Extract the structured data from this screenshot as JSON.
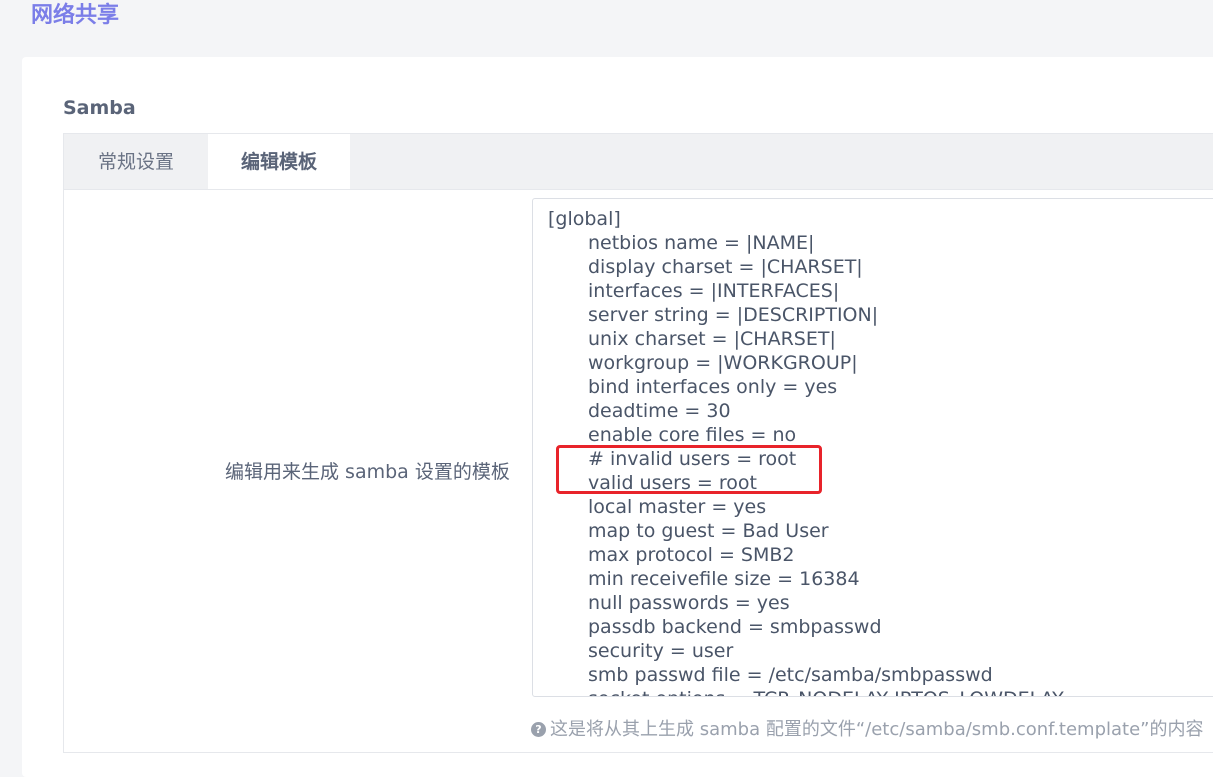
{
  "page": {
    "title": "网络共享"
  },
  "section": {
    "title": "Samba"
  },
  "tabs": [
    {
      "label": "常规设置",
      "active": false
    },
    {
      "label": "编辑模板",
      "active": true
    }
  ],
  "template_field": {
    "label": "编辑用来生成 samba 设置的模板",
    "lines": [
      {
        "text": "[global]",
        "indent": false
      },
      {
        "text": "netbios name = |NAME|",
        "indent": true
      },
      {
        "text": "display charset = |CHARSET|",
        "indent": true
      },
      {
        "text": "interfaces = |INTERFACES|",
        "indent": true
      },
      {
        "text": "server string = |DESCRIPTION|",
        "indent": true
      },
      {
        "text": "unix charset = |CHARSET|",
        "indent": true
      },
      {
        "text": "workgroup = |WORKGROUP|",
        "indent": true
      },
      {
        "text": "bind interfaces only = yes",
        "indent": true
      },
      {
        "text": "deadtime = 30",
        "indent": true
      },
      {
        "text": "enable core files = no",
        "indent": true
      },
      {
        "text": "# invalid users = root",
        "indent": true
      },
      {
        "text": "valid users = root",
        "indent": true
      },
      {
        "text": "local master = yes",
        "indent": true
      },
      {
        "text": "map to guest = Bad User",
        "indent": true
      },
      {
        "text": "max protocol = SMB2",
        "indent": true
      },
      {
        "text": "min receivefile size = 16384",
        "indent": true
      },
      {
        "text": "null passwords = yes",
        "indent": true
      },
      {
        "text": "passdb backend = smbpasswd",
        "indent": true
      },
      {
        "text": "security = user",
        "indent": true
      },
      {
        "text": "smb passwd file = /etc/samba/smbpasswd",
        "indent": true
      },
      {
        "text": "socket options = TCP_NODELAY IPTOS_LOWDELAY",
        "indent": true
      }
    ],
    "help_text": "这是将从其上生成 samba 配置的文件“/etc/samba/smb.conf.template”的内容"
  },
  "colors": {
    "accent": "#7b7ee8",
    "highlight": "#e8232a"
  },
  "icons": {
    "help": "question-circle-icon"
  }
}
